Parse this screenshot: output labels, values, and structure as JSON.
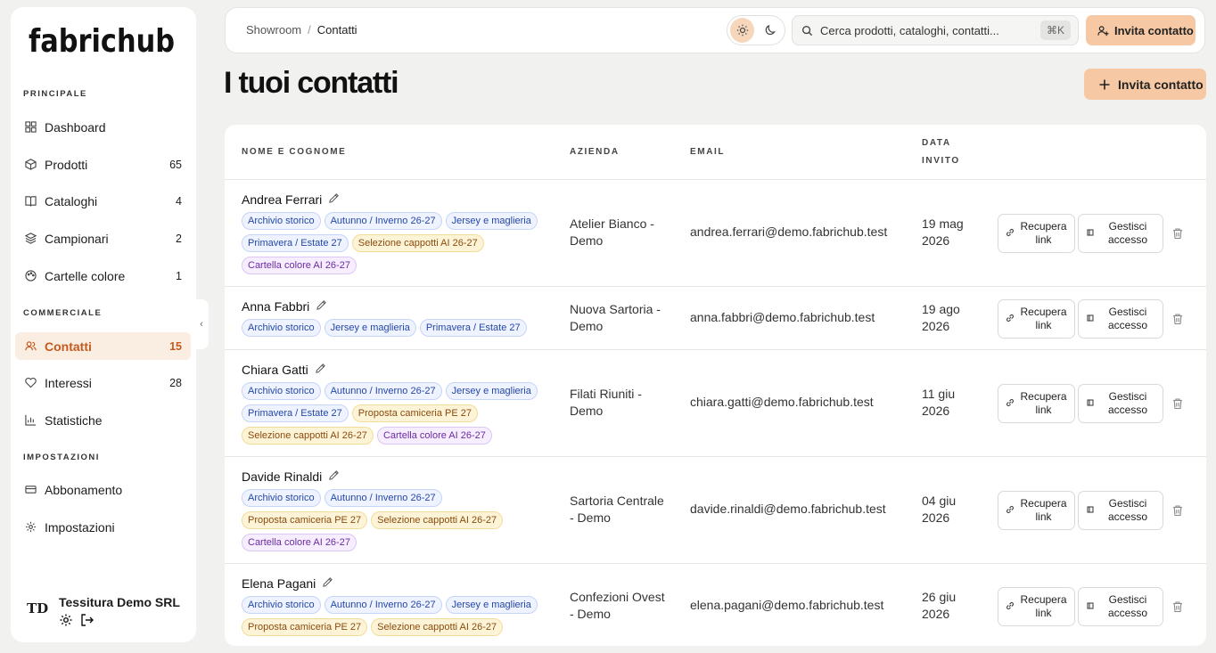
{
  "brand": {
    "logo": "fabrichub",
    "accent": "#f6c9a4",
    "active_text": "#c45a1f"
  },
  "sidebar": {
    "sections": [
      {
        "label": "PRINCIPALE"
      },
      {
        "label": "COMMERCIALE"
      },
      {
        "label": "IMPOSTAZIONI"
      }
    ],
    "items": [
      {
        "label": "Dashboard",
        "count": "",
        "icon": "dashboard-icon"
      },
      {
        "label": "Prodotti",
        "count": "65",
        "icon": "package-icon"
      },
      {
        "label": "Cataloghi",
        "count": "4",
        "icon": "book-icon"
      },
      {
        "label": "Campionari",
        "count": "2",
        "icon": "layers-icon"
      },
      {
        "label": "Cartelle colore",
        "count": "1",
        "icon": "palette-icon"
      },
      {
        "label": "Contatti",
        "count": "15",
        "icon": "users-icon",
        "active": true
      },
      {
        "label": "Interessi",
        "count": "28",
        "icon": "heart-icon"
      },
      {
        "label": "Statistiche",
        "count": "",
        "icon": "chart-icon"
      },
      {
        "label": "Abbonamento",
        "count": "",
        "icon": "card-icon"
      },
      {
        "label": "Impostazioni",
        "count": "",
        "icon": "gear-icon"
      }
    ],
    "org": {
      "logo": "TD",
      "name": "Tessitura Demo SRL"
    }
  },
  "topbar": {
    "breadcrumb": [
      "Showroom",
      "Contatti"
    ],
    "search_placeholder": "Cerca prodotti, cataloghi, contatti...",
    "shortcut": "⌘K",
    "invite_label": "Invita contatto"
  },
  "page": {
    "title": "I tuoi contatti",
    "invite_label": "Invita contatto"
  },
  "table": {
    "headers": {
      "name": "NOME E COGNOME",
      "company": "AZIENDA",
      "email": "EMAIL",
      "date_line1": "DATA",
      "date_line2": "INVITO"
    },
    "actions": {
      "recover_l1": "Recupera",
      "recover_l2": "link",
      "manage_l1": "Gestisci",
      "manage_l2": "accesso"
    },
    "rows": [
      {
        "name": "Andrea Ferrari",
        "tags": [
          {
            "text": "Archivio storico",
            "color": "blue"
          },
          {
            "text": "Autunno / Inverno 26-27",
            "color": "blue"
          },
          {
            "text": "Jersey e maglieria",
            "color": "blue"
          },
          {
            "text": "Primavera / Estate 27",
            "color": "blue"
          },
          {
            "text": "Selezione cappotti AI 26-27",
            "color": "yellow"
          },
          {
            "text": "Cartella colore AI 26-27",
            "color": "purple"
          }
        ],
        "company_l1": "Atelier Bianco -",
        "company_l2": "Demo",
        "email": "andrea.ferrari@demo.fabrichub.test",
        "date_l1": "19 mag",
        "date_l2": "2026"
      },
      {
        "name": "Anna Fabbri",
        "tags": [
          {
            "text": "Archivio storico",
            "color": "blue"
          },
          {
            "text": "Jersey e maglieria",
            "color": "blue"
          },
          {
            "text": "Primavera / Estate 27",
            "color": "blue"
          }
        ],
        "company_l1": "Nuova Sartoria -",
        "company_l2": "Demo",
        "email": "anna.fabbri@demo.fabrichub.test",
        "date_l1": "19 ago",
        "date_l2": "2026"
      },
      {
        "name": "Chiara Gatti",
        "tags": [
          {
            "text": "Archivio storico",
            "color": "blue"
          },
          {
            "text": "Autunno / Inverno 26-27",
            "color": "blue"
          },
          {
            "text": "Jersey e maglieria",
            "color": "blue"
          },
          {
            "text": "Primavera / Estate 27",
            "color": "blue"
          },
          {
            "text": "Proposta camiceria PE 27",
            "color": "yellow"
          },
          {
            "text": "Selezione cappotti AI 26-27",
            "color": "yellow"
          },
          {
            "text": "Cartella colore AI 26-27",
            "color": "purple"
          }
        ],
        "company_l1": "Filati Riuniti -",
        "company_l2": "Demo",
        "email": "chiara.gatti@demo.fabrichub.test",
        "date_l1": "11 giu",
        "date_l2": "2026"
      },
      {
        "name": "Davide Rinaldi",
        "tags": [
          {
            "text": "Archivio storico",
            "color": "blue"
          },
          {
            "text": "Autunno / Inverno 26-27",
            "color": "blue"
          },
          {
            "text": "Proposta camiceria PE 27",
            "color": "yellow"
          },
          {
            "text": "Selezione cappotti AI 26-27",
            "color": "yellow"
          },
          {
            "text": "Cartella colore AI 26-27",
            "color": "purple"
          }
        ],
        "company_l1": "Sartoria Centrale",
        "company_l2": "- Demo",
        "email": "davide.rinaldi@demo.fabrichub.test",
        "date_l1": "04 giu",
        "date_l2": "2026"
      },
      {
        "name": "Elena Pagani",
        "tags": [
          {
            "text": "Archivio storico",
            "color": "blue"
          },
          {
            "text": "Autunno / Inverno 26-27",
            "color": "blue"
          },
          {
            "text": "Jersey e maglieria",
            "color": "blue"
          },
          {
            "text": "Proposta camiceria PE 27",
            "color": "yellow"
          },
          {
            "text": "Selezione cappotti AI 26-27",
            "color": "yellow"
          }
        ],
        "company_l1": "Confezioni Ovest",
        "company_l2": "- Demo",
        "email": "elena.pagani@demo.fabrichub.test",
        "date_l1": "26 giu",
        "date_l2": "2026"
      }
    ]
  }
}
